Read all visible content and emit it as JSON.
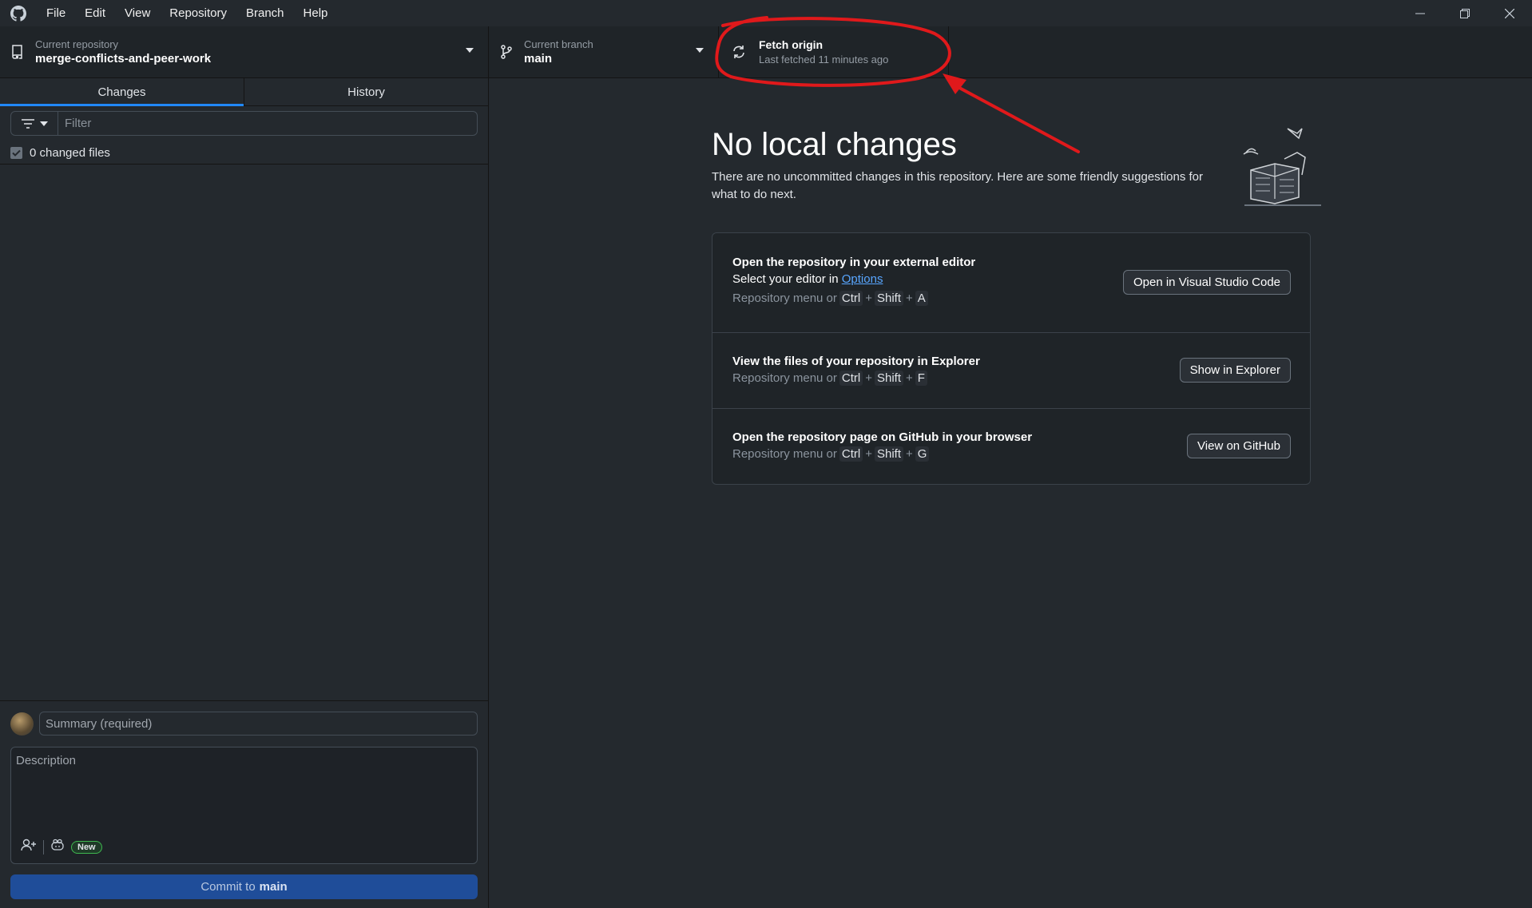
{
  "menu": {
    "items": [
      "File",
      "Edit",
      "View",
      "Repository",
      "Branch",
      "Help"
    ]
  },
  "toolbar": {
    "repo_label": "Current repository",
    "repo_value": "merge-conflicts-and-peer-work",
    "branch_label": "Current branch",
    "branch_value": "main",
    "fetch_title": "Fetch origin",
    "fetch_sub": "Last fetched 11 minutes ago"
  },
  "sidebar": {
    "tabs": [
      "Changes",
      "History"
    ],
    "active_tab": "Changes",
    "filter_placeholder": "Filter",
    "changed_files": "0 changed files",
    "summary_placeholder": "Summary (required)",
    "description_placeholder": "Description",
    "new_badge": "New",
    "commit_prefix": "Commit to",
    "commit_branch": "main"
  },
  "main": {
    "title": "No local changes",
    "subtitle": "There are no uncommitted changes in this repository. Here are some friendly suggestions for what to do next.",
    "actions": [
      {
        "title": "Open the repository in your external editor",
        "desc_prefix": "Select your editor in",
        "desc_link": "Options",
        "kbd_prefix": "Repository menu or",
        "keys": [
          "Ctrl",
          "Shift",
          "A"
        ],
        "button": "Open in Visual Studio Code"
      },
      {
        "title": "View the files of your repository in Explorer",
        "kbd_prefix": "Repository menu or",
        "keys": [
          "Ctrl",
          "Shift",
          "F"
        ],
        "button": "Show in Explorer"
      },
      {
        "title": "Open the repository page on GitHub in your browser",
        "kbd_prefix": "Repository menu or",
        "keys": [
          "Ctrl",
          "Shift",
          "G"
        ],
        "button": "View on GitHub"
      }
    ]
  },
  "colors": {
    "background": "#24292e",
    "toolbar": "#1f2428",
    "accent": "#2188ff",
    "link": "#58a6ff",
    "commit_button": "#1f4d99",
    "annotation": "#e0191b"
  },
  "icons": [
    "github-logo-icon",
    "repo-icon",
    "branch-icon",
    "sync-icon",
    "filter-icon",
    "coauthor-icon",
    "copilot-icon",
    "minimize-icon",
    "restore-icon",
    "close-icon"
  ]
}
